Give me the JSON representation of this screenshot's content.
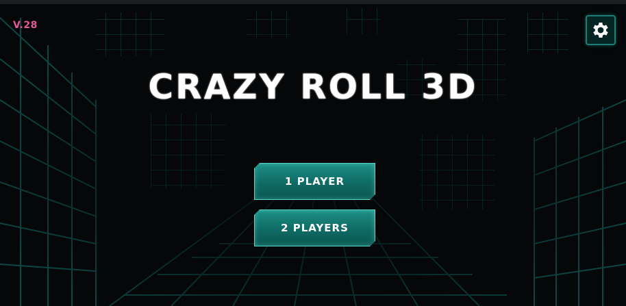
{
  "app": {
    "version": "V.28",
    "title": "CRAZY ROLL 3D"
  },
  "menu": {
    "one_player": "1 PLAYER",
    "two_players": "2 PLAYERS"
  },
  "icons": {
    "settings": "gear-icon"
  },
  "colors": {
    "accent": "#15837b",
    "version_text": "#e25a9a",
    "grid_line": "#0d4f4a"
  }
}
